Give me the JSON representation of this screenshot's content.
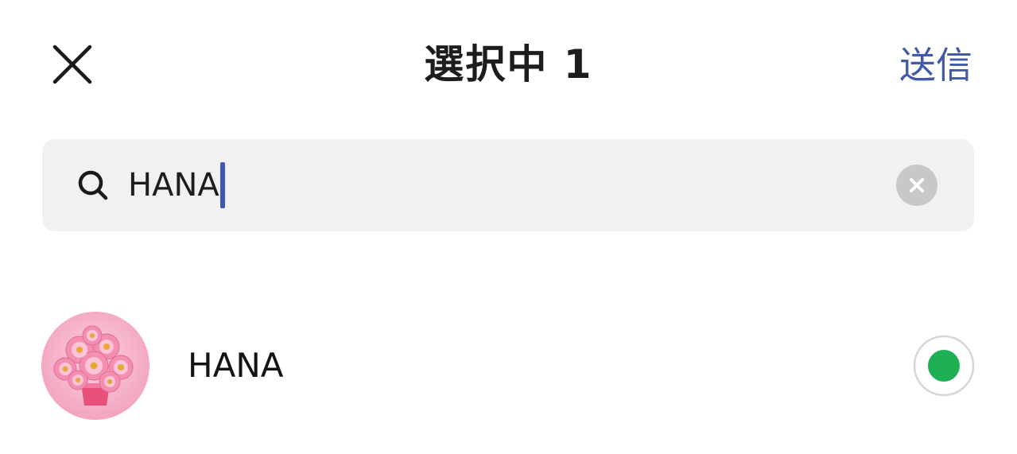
{
  "header": {
    "title": "選択中 1",
    "send_label": "送信",
    "close_icon": "close-icon",
    "accent_color": "#4159a6"
  },
  "search": {
    "value": "HANA",
    "search_icon": "search-icon",
    "clear_icon": "clear-icon",
    "background": "#f2f1f2"
  },
  "results": [
    {
      "name": "HANA",
      "avatar": "pink-flowers-avatar",
      "selected": true,
      "selected_color": "#1db153"
    }
  ]
}
